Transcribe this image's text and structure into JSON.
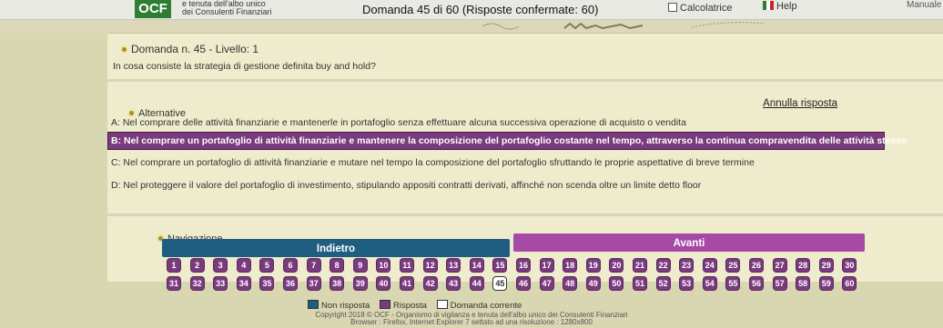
{
  "header": {
    "logo": "OCF",
    "org_line1": "e tenuta dell'albo unico",
    "org_line2": "dei Consulenti Finanziari",
    "title": "Domanda 45 di 60 (Risposte confermate: 60)",
    "calculator": "Calcolatrice",
    "help": "Help",
    "manual": "Manuale"
  },
  "question": {
    "heading": "Domanda n. 45 - Livello: 1",
    "text": "In cosa consiste la strategia di gestione definita buy and hold?"
  },
  "alternatives": {
    "heading": "Alternative",
    "cancel_label": "Annulla risposta",
    "items": [
      {
        "label": "A: Nel comprare delle attività finanziarie e mantenerle in portafoglio senza effettuare alcuna successiva operazione di acquisto o vendita",
        "selected": false
      },
      {
        "label": "B: Nel comprare un portafoglio di attività finanziarie e mantenere la composizione del portafoglio costante nel tempo, attraverso la continua compravendita delle attività stesse",
        "selected": true
      },
      {
        "label": "C: Nel comprare un portafoglio di attività finanziarie e mutare nel tempo la composizione del portafoglio sfruttando le proprie aspettative di breve termine",
        "selected": false
      },
      {
        "label": "D: Nel proteggere il valore del portafoglio di investimento, stipulando appositi contratti derivati, affinché non scenda oltre un limite detto floor",
        "selected": false
      }
    ]
  },
  "navigation": {
    "heading": "Navigazione",
    "back_label": "Indietro",
    "next_label": "Avanti",
    "current": 45,
    "total": 60
  },
  "legend": {
    "not_answered": "Non risposta",
    "answered": "Risposta",
    "current": "Domanda corrente"
  },
  "footer": {
    "line1": "Copyright 2018 © OCF - Organismo di vigilanza e tenuta dell'albo unico dei Consulenti Finanziari",
    "line2": "Browser : Firefox, Internet Explorer 7 settato ad una risoluzione : 1280x800"
  },
  "colors": {
    "answered": "#7a3a7e",
    "back_button": "#1f5e80",
    "next_button": "#a74aa6"
  }
}
